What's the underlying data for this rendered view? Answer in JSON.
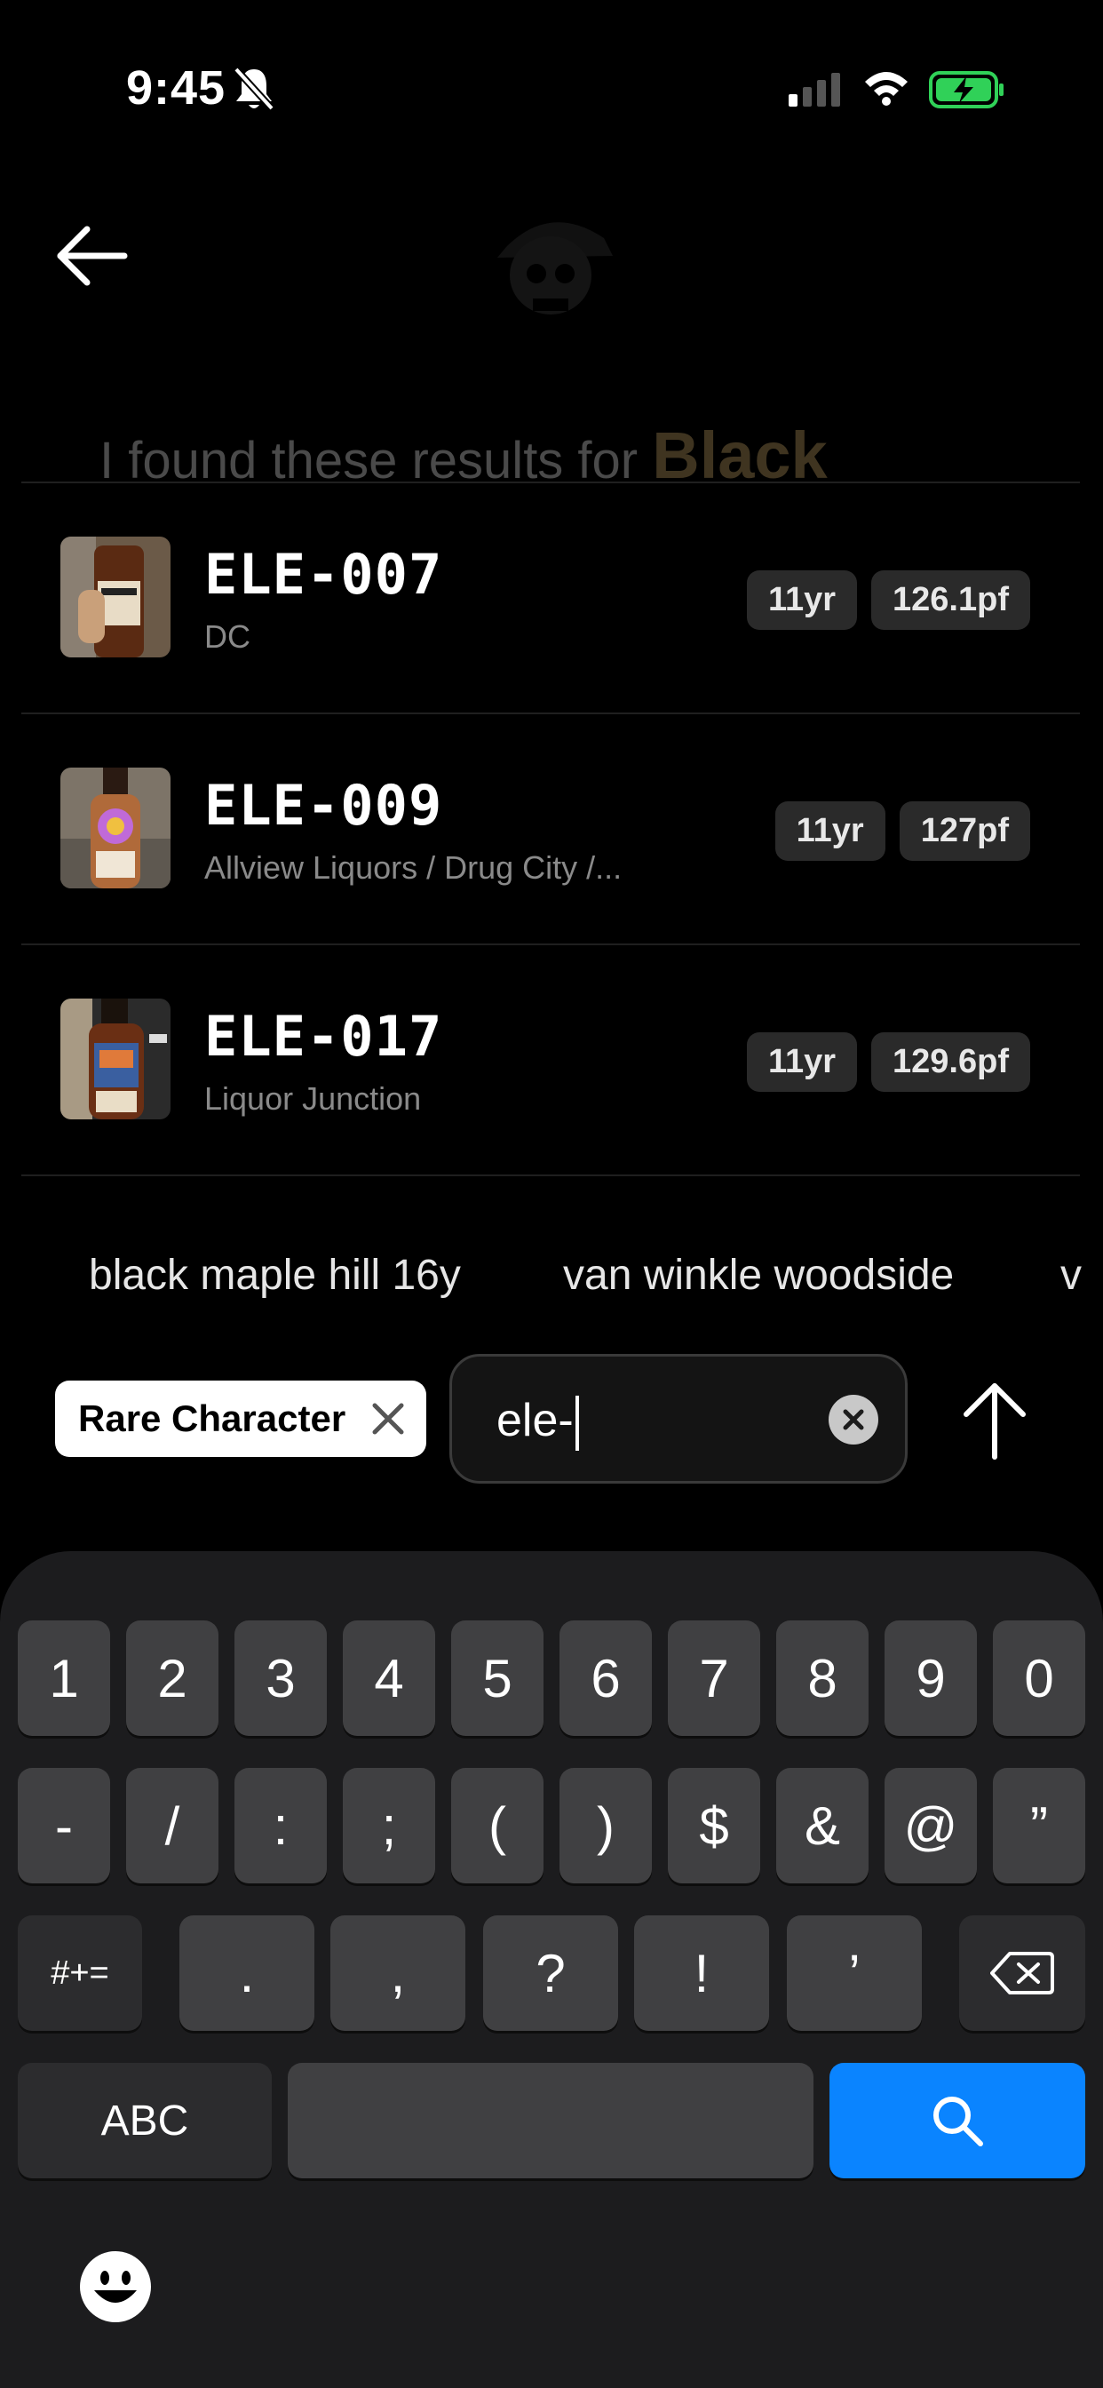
{
  "status_bar": {
    "time": "9:45",
    "icons": [
      "bell-off-icon",
      "signal-icon",
      "wifi-icon",
      "battery-charging-icon"
    ]
  },
  "header": {
    "back_icon": "arrow-left-icon",
    "avatar_icon": "skull-avatar-icon"
  },
  "results": {
    "title_prefix": "I found these results for",
    "title_keyword": "Black",
    "items": [
      {
        "code": "ELE-007",
        "store": "DC",
        "age": "11yr",
        "proof": "126.1pf"
      },
      {
        "code": "ELE-009",
        "store": "Allview Liquors / Drug City /...",
        "age": "11yr",
        "proof": "127pf"
      },
      {
        "code": "ELE-017",
        "store": "Liquor Junction",
        "age": "11yr",
        "proof": "129.6pf"
      }
    ]
  },
  "suggestions": [
    "black maple hill 16y",
    "van winkle woodside",
    "v"
  ],
  "search": {
    "chip_label": "Rare Character",
    "value": "ele-",
    "clear_icon": "clear-x-icon",
    "send_icon": "arrow-up-icon"
  },
  "keyboard": {
    "row1": [
      "1",
      "2",
      "3",
      "4",
      "5",
      "6",
      "7",
      "8",
      "9",
      "0"
    ],
    "row2": [
      "-",
      "/",
      ":",
      ";",
      "(",
      ")",
      "$",
      "&",
      "@",
      "”"
    ],
    "row3_left": "#+=",
    "row3": [
      ".",
      ",",
      "?",
      "!",
      "’"
    ],
    "row3_right_icon": "backspace-icon",
    "abc_label": "ABC",
    "search_icon": "search-icon",
    "emoji_icon": "emoji-icon"
  },
  "colors": {
    "background": "#000000",
    "tag_bg": "#2a2a2a",
    "key_bg": "#404042",
    "search_key": "#0a84ff",
    "battery_green": "#30d158"
  }
}
